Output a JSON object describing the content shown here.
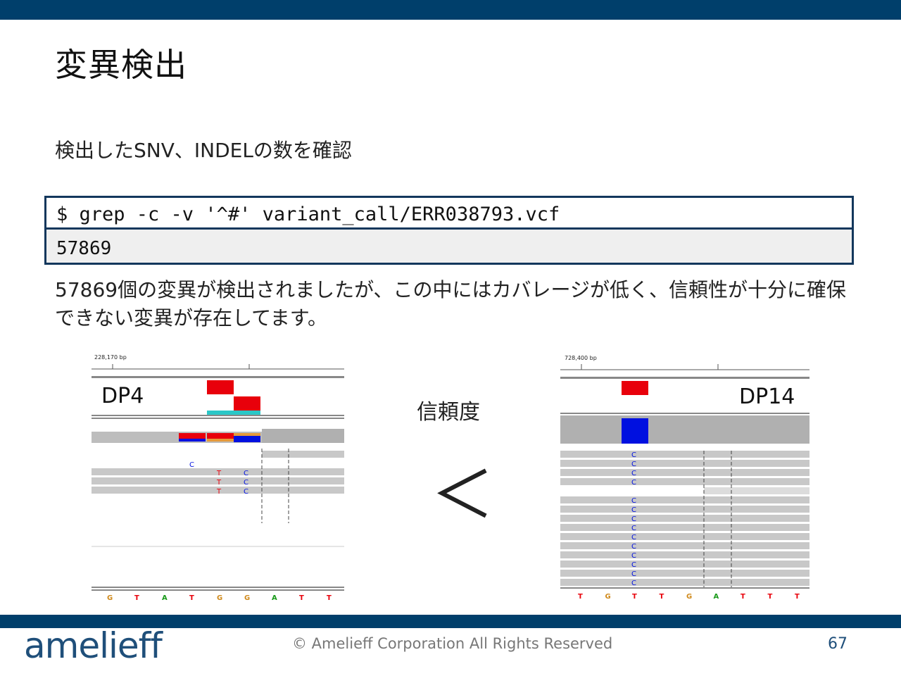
{
  "slide": {
    "title": "変異検出",
    "subtitle": "検出したSNV、INDELの数を確認",
    "command": "$ grep -c -v '^#' variant_call/ERR038793.vcf",
    "output": "57869",
    "body": "57869個の変異が検出されましたが、この中にはカバレージが低く、信頼性が十分に確保できない変異が存在してます。",
    "comparison_label": "信頼度",
    "comparison_symbol": "＜",
    "footer": {
      "logo": "amelieff",
      "copyright": "© Amelieff Corporation All Rights Reserved",
      "page_number": "67"
    }
  },
  "left_panel": {
    "ruler": "228,170 bp",
    "label": "DP4",
    "bases": [
      "G",
      "T",
      "A",
      "T",
      "G",
      "G",
      "A",
      "T",
      "T"
    ]
  },
  "right_panel": {
    "ruler": "728,400 bp",
    "label": "DP14",
    "bases": [
      "T",
      "G",
      "T",
      "T",
      "G",
      "A",
      "T",
      "T",
      "T"
    ]
  },
  "colors": {
    "brand": "#003f6b",
    "snv_red": "#e8000b",
    "snv_blue": "#0010e0"
  }
}
